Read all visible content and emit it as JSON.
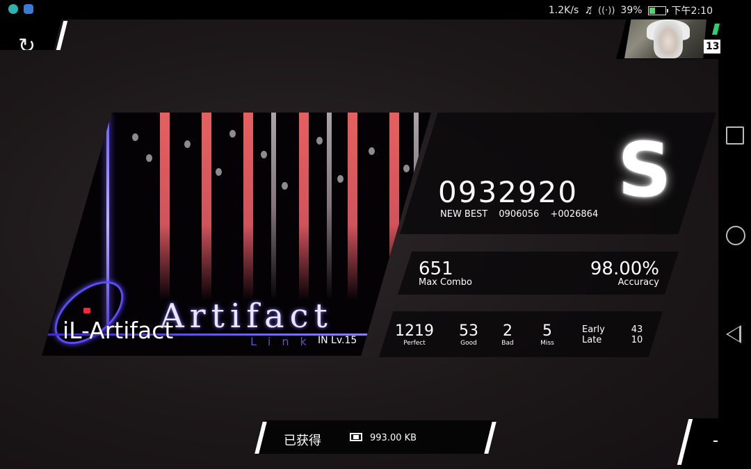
{
  "status_bar": {
    "net_speed": "1.2K/s",
    "battery": "39%",
    "battery_level": 0.39,
    "time": "下午2:10",
    "left_icons": [
      "app-icon-teal",
      "app-icon-blue"
    ]
  },
  "top": {
    "retry_icon": "↻",
    "rank": "13"
  },
  "song": {
    "title": "iL-Artifact",
    "difficulty": "IN  Lv.15",
    "art_word": "Artifact",
    "art_sub": "Link"
  },
  "score": {
    "value": "0932920",
    "new_best_label": "NEW BEST",
    "previous_best": "0906056",
    "delta": "+0026864",
    "grade": "S"
  },
  "combo": {
    "max_combo": "651",
    "max_combo_label": "Max Combo",
    "accuracy": "98.00%",
    "accuracy_label": "Accuracy"
  },
  "judgements": {
    "perfect": "1219",
    "perfect_label": "Perfect",
    "good": "53",
    "good_label": "Good",
    "bad": "2",
    "bad_label": "Bad",
    "miss": "5",
    "miss_label": "Miss",
    "early_label": "Early",
    "early": "43",
    "late_label": "Late",
    "late": "10"
  },
  "bottom": {
    "obtained_label": "已获得",
    "data_size": "993.00 KB"
  },
  "colors": {
    "accent_green": "#2bd26b",
    "grade_glow": "#ffffff",
    "art_blue": "#5d4bff",
    "art_red": "#ff6a6a"
  }
}
